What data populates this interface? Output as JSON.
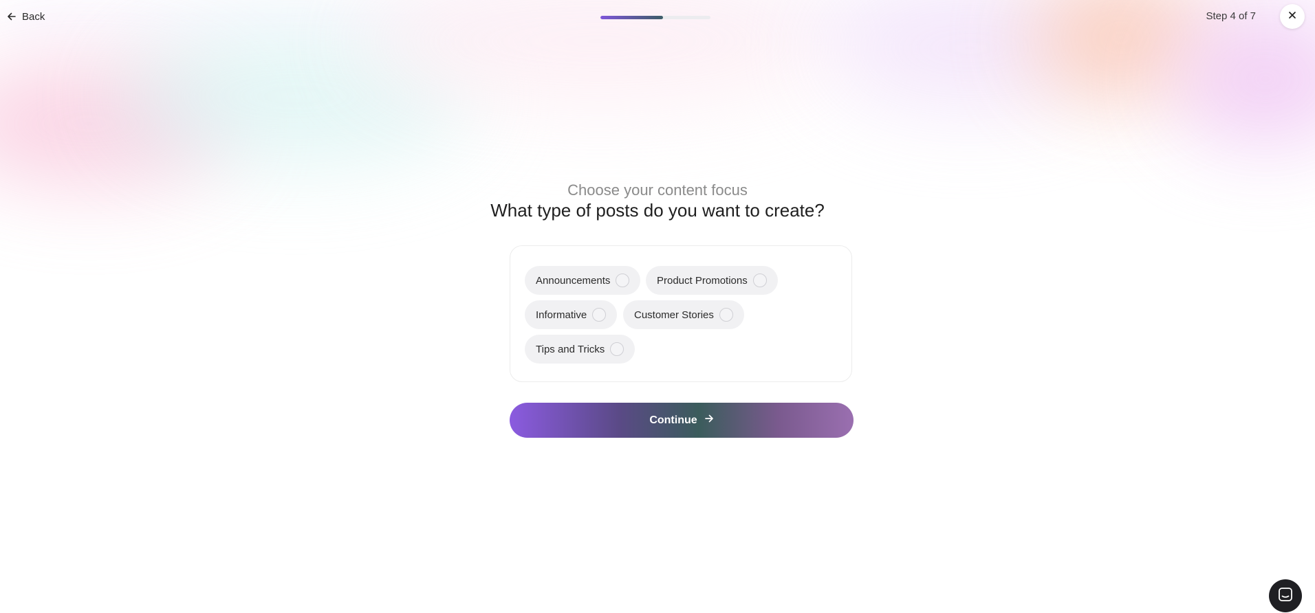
{
  "header": {
    "back_label": "Back",
    "step_label": "Step 4 of 7",
    "progress": {
      "current_step": 4,
      "total_steps": 7,
      "fraction": 0.571
    }
  },
  "main": {
    "subtitle": "Choose your content focus",
    "title": "What type of posts do you want to create?",
    "options": [
      {
        "label": "Announcements",
        "selected": false
      },
      {
        "label": "Product Promotions",
        "selected": false
      },
      {
        "label": "Informative",
        "selected": false
      },
      {
        "label": "Customer Stories",
        "selected": false
      },
      {
        "label": "Tips and Tricks",
        "selected": false
      }
    ],
    "continue_label": "Continue"
  },
  "icons": {
    "back": "arrow-left-icon",
    "close": "close-icon",
    "continue": "arrow-right-icon",
    "chat": "chat-icon"
  },
  "colors": {
    "accent_start": "#8b5be0",
    "accent_mid": "#3b5c5c",
    "accent_end": "#9a6fb0",
    "chip_bg": "#f1f1f3"
  }
}
